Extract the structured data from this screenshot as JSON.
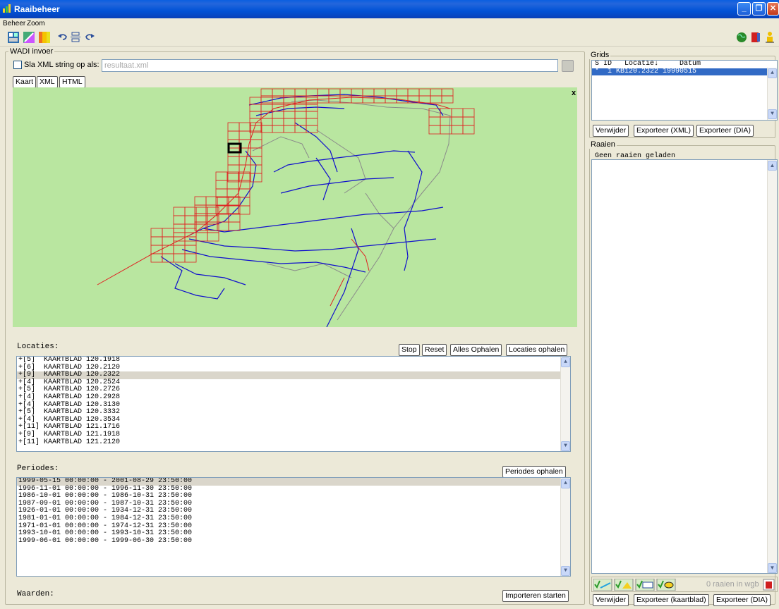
{
  "window": {
    "title": "Raaibeheer",
    "minimize": "_",
    "restore": "❐",
    "close": "✕"
  },
  "menu": {
    "items": [
      "Beheer",
      "Zoom"
    ]
  },
  "wadi": {
    "group_label": "WADI invoer",
    "save_xml_label": "Sla XML string op als:",
    "save_xml_placeholder": "resultaat.xml",
    "tabs": [
      "Kaart",
      "XML",
      "HTML"
    ],
    "map_close": "x",
    "locaties_label": "Locaties:",
    "locaties_buttons": [
      "Stop",
      "Reset",
      "Alles Ophalen",
      "Locaties ophalen"
    ],
    "locaties": [
      "+[5]  KAARTBLAD 120.1918",
      "+[6]  KAARTBLAD 120.2120",
      "+[9]  KAARTBLAD 120.2322",
      "+[4]  KAARTBLAD 120.2524",
      "+[5]  KAARTBLAD 120.2726",
      "+[4]  KAARTBLAD 120.2928",
      "+[4]  KAARTBLAD 120.3130",
      "+[5]  KAARTBLAD 120.3332",
      "+[4]  KAARTBLAD 120.3534",
      "+[11] KAARTBLAD 121.1716",
      "+[9]  KAARTBLAD 121.1918",
      "+[11] KAARTBLAD 121.2120"
    ],
    "periodes_label": "Periodes:",
    "periodes_button": "Periodes ophalen",
    "periodes": [
      "1999-05-15 00:00:00 - 2001-08-29 23:50:00",
      "1996-11-01 00:00:00 - 1996-11-30 23:50:00",
      "1986-10-01 00:00:00 - 1986-10-31 23:50:00",
      "1987-09-01 00:00:00 - 1987-10-31 23:50:00",
      "1926-01-01 00:00:00 - 1934-12-31 23:50:00",
      "1981-01-01 00:00:00 - 1984-12-31 23:50:00",
      "1971-01-01 00:00:00 - 1974-12-31 23:50:00",
      "1993-10-01 00:00:00 - 1993-10-31 23:50:00",
      "1999-06-01 00:00:00 - 1999-06-30 23:50:00"
    ],
    "waarden_label": "Waarden:",
    "import_button": "Importeren starten"
  },
  "grids": {
    "group_label": "Grids",
    "header": "S ID   Locatie↓     Datum",
    "row": "*  1 KB120.2322 19990515",
    "buttons": [
      "Verwijder",
      "Exporteer (XML)",
      "Exporteer (DIA)"
    ]
  },
  "raaien": {
    "group_label": "Raaien",
    "empty_text": "Geen raaien geladen",
    "status": "0 raaien in wgb",
    "buttons": [
      "Verwijder",
      "Exporteer (kaartblad)",
      "Exporteer (DIA)"
    ]
  },
  "colors": {
    "map_bg": "#b9e6a0",
    "grid_line": "#e02020",
    "river": "#1010cc",
    "border": "#8a8a8a"
  }
}
